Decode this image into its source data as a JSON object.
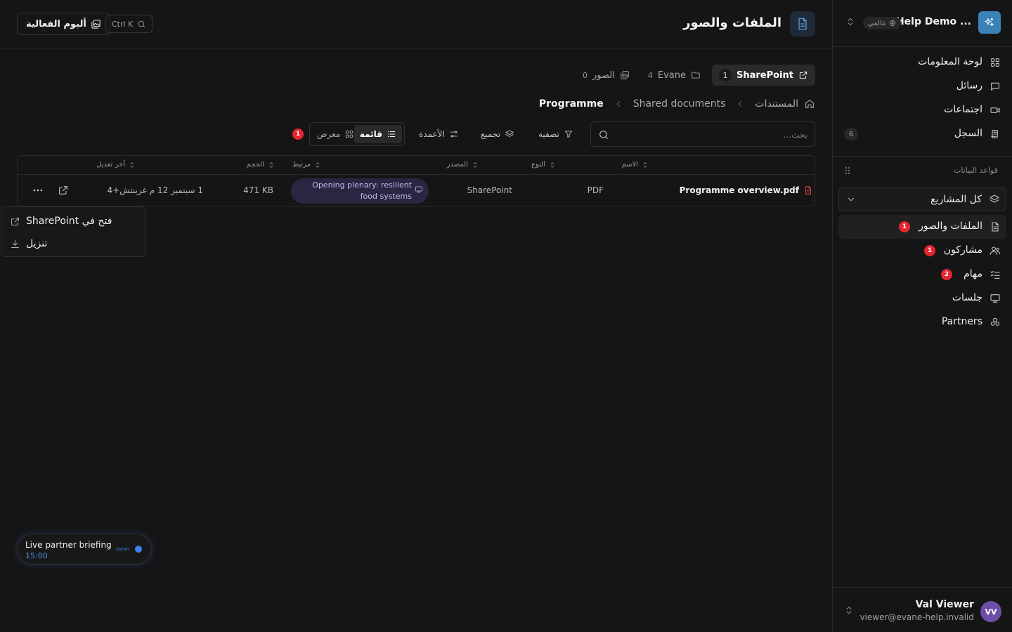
{
  "workspace": {
    "name": "Help Demo ...",
    "scope_badge": "عالمي"
  },
  "nav": [
    {
      "label": "لوحة المعلومات",
      "icon": "dashboard-icon"
    },
    {
      "label": "رسائل",
      "icon": "message-icon"
    },
    {
      "label": "اجتماعات",
      "icon": "video-icon"
    },
    {
      "label": "السجل",
      "icon": "log-icon",
      "count": "6"
    }
  ],
  "databases": {
    "title": "قواعد البيانات",
    "project_selector": "كل المشاريع",
    "items": [
      {
        "label": "الملفات والصور",
        "badge": "1",
        "active": true
      },
      {
        "label": "مشاركون",
        "badge": "1"
      },
      {
        "label": "مهام",
        "badge": "2"
      },
      {
        "label": "جلسات",
        "badge": ""
      },
      {
        "label": "Partners",
        "badge": ""
      }
    ]
  },
  "user": {
    "initials": "VV",
    "name": "Val Viewer",
    "email": "viewer@evane-help.invalid"
  },
  "header": {
    "title": "الملفات والصور",
    "album_button": "ألبوم الفعالية",
    "shortcut": "Ctrl K"
  },
  "source_tabs": [
    {
      "label": "SharePoint",
      "count": "1",
      "active": true
    },
    {
      "label": "Evane",
      "count": "4"
    },
    {
      "label": "الصور",
      "count": "0"
    }
  ],
  "breadcrumb": [
    "المستندات",
    "Shared documents",
    "Programme"
  ],
  "toolbar": {
    "search_placeholder": "بحث...",
    "filter": "تصفية",
    "group": "تجميع",
    "columns": "الأعمدة",
    "view_list": "قائمة",
    "view_gallery": "معرض",
    "notice_badge": "1"
  },
  "table": {
    "columns": {
      "name": "الاسم",
      "type": "النوع",
      "source": "المصدر",
      "linked": "مرتبط",
      "size": "الحجم",
      "modified": "آخر تعديل"
    },
    "rows": [
      {
        "name": "Programme overview.pdf",
        "type": "PDF",
        "source": "SharePoint",
        "linked": "Opening plenary: resilient food systems",
        "size": "471 KB",
        "modified": "1 سبتمبر 12 م غرينتش+4"
      }
    ]
  },
  "context_menu": {
    "open": "فتح في SharePoint",
    "download": "تنزيل"
  },
  "live_meeting": {
    "title": "Live partner briefing",
    "time": "15:00",
    "provider": "zoom"
  }
}
